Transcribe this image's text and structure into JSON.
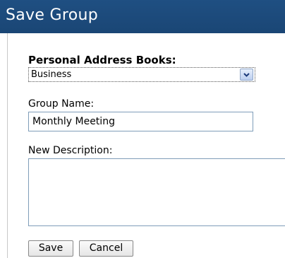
{
  "header": {
    "title": "Save Group",
    "background": "#1f4f82"
  },
  "form": {
    "address_books_label": "Personal Address Books:",
    "address_books_selected": "Business",
    "group_name_label": "Group Name:",
    "group_name_value": "Monthly Meeting",
    "description_label": "New Description:",
    "description_value": ""
  },
  "buttons": {
    "save": "Save",
    "cancel": "Cancel"
  }
}
